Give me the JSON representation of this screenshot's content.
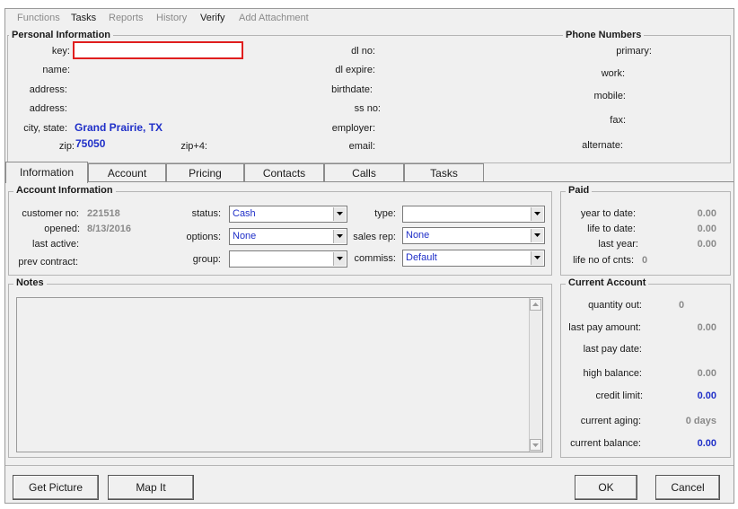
{
  "menu": {
    "functions": "Functions",
    "tasks": "Tasks",
    "reports": "Reports",
    "history": "History",
    "verify": "Verify",
    "add_attachment": "Add Attachment"
  },
  "personal": {
    "title": "Personal Information",
    "key_label": "key:",
    "key_value": "",
    "name_label": "name:",
    "address1_label": "address:",
    "address2_label": "address:",
    "city_state_label": "city, state:",
    "city_state_value": "Grand Prairie, TX",
    "zip_label": "zip:",
    "zip_value": "75050",
    "zip4_label": "zip+4:",
    "dl_no_label": "dl no:",
    "dl_expire_label": "dl expire:",
    "birthdate_label": "birthdate:",
    "ss_no_label": "ss no:",
    "employer_label": "employer:",
    "email_label": "email:"
  },
  "phone": {
    "title": "Phone Numbers",
    "primary_label": "primary:",
    "work_label": "work:",
    "mobile_label": "mobile:",
    "fax_label": "fax:",
    "alternate_label": "alternate:"
  },
  "tabs": [
    "Information",
    "Account",
    "Pricing",
    "Contacts",
    "Calls",
    "Tasks"
  ],
  "account": {
    "title": "Account Information",
    "customer_no_label": "customer no:",
    "customer_no_value": "221518",
    "opened_label": "opened:",
    "opened_value": "8/13/2016",
    "last_active_label": "last active:",
    "prev_contract_label": "prev contract:",
    "status_label": "status:",
    "status_value": "Cash",
    "options_label": "options:",
    "options_value": "None",
    "group_label": "group:",
    "group_value": "",
    "type_label": "type:",
    "type_value": "",
    "sales_rep_label": "sales rep:",
    "sales_rep_value": "None",
    "commiss_label": "commiss:",
    "commiss_value": "Default"
  },
  "paid": {
    "title": "Paid",
    "ytd_label": "year to date:",
    "ytd_value": "0.00",
    "ltd_label": "life to date:",
    "ltd_value": "0.00",
    "last_year_label": "last year:",
    "last_year_value": "0.00",
    "cnts_label": "life no of cnts:",
    "cnts_value": "0"
  },
  "notes": {
    "title": "Notes"
  },
  "current": {
    "title": "Current Account",
    "qty_out_label": "quantity out:",
    "qty_out_value": "0",
    "last_pay_amount_label": "last pay amount:",
    "last_pay_amount_value": "0.00",
    "last_pay_date_label": "last pay date:",
    "high_balance_label": "high balance:",
    "high_balance_value": "0.00",
    "credit_limit_label": "credit limit:",
    "credit_limit_value": "0.00",
    "current_aging_label": "current aging:",
    "current_aging_value": "0 days",
    "current_balance_label": "current balance:",
    "current_balance_value": "0.00"
  },
  "buttons": {
    "get_picture": "Get Picture",
    "map_it": "Map It",
    "ok": "OK",
    "cancel": "Cancel"
  },
  "colors": {
    "accent_blue": "#1f2fc8",
    "key_border": "#e01e1e"
  }
}
